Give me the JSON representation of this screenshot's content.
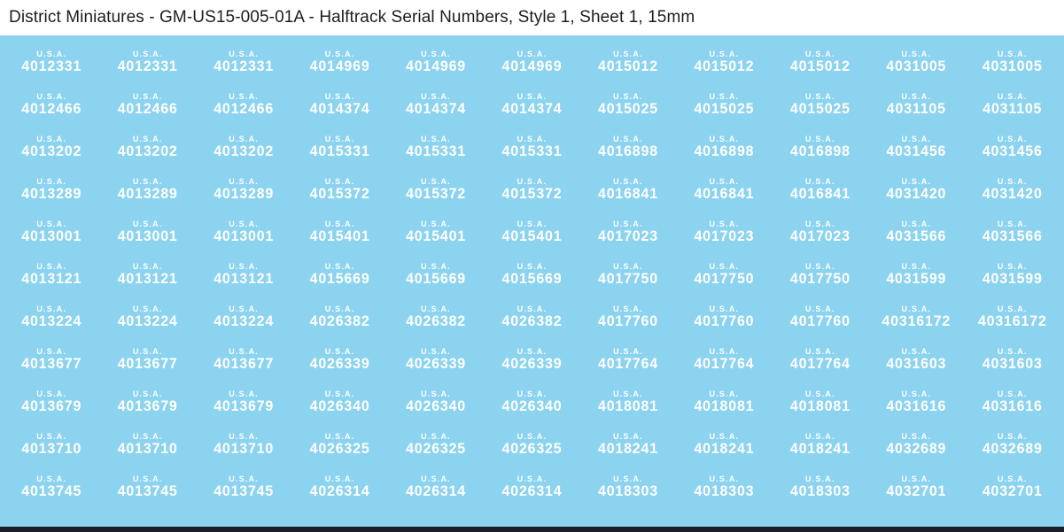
{
  "header": {
    "title": "District Miniatures - GM-US15-005-01A - Halftrack Serial Numbers, Style 1, Sheet 1, 15mm"
  },
  "decal": {
    "label": "U.S.A.",
    "rows": [
      [
        "4012331",
        "4012331",
        "4012331",
        "4014969",
        "4014969",
        "4014969",
        "4015012",
        "4015012",
        "4015012",
        "4031005",
        "4031005"
      ],
      [
        "4012466",
        "4012466",
        "4012466",
        "4014374",
        "4014374",
        "4014374",
        "4015025",
        "4015025",
        "4015025",
        "4031105",
        "4031105"
      ],
      [
        "4013202",
        "4013202",
        "4013202",
        "4015331",
        "4015331",
        "4015331",
        "4016898",
        "4016898",
        "4016898",
        "4031456",
        "4031456"
      ],
      [
        "4013289",
        "4013289",
        "4013289",
        "4015372",
        "4015372",
        "4015372",
        "4016841",
        "4016841",
        "4016841",
        "4031420",
        "4031420"
      ],
      [
        "4013001",
        "4013001",
        "4013001",
        "4015401",
        "4015401",
        "4015401",
        "4017023",
        "4017023",
        "4017023",
        "4031566",
        "4031566"
      ],
      [
        "4013121",
        "4013121",
        "4013121",
        "4015669",
        "4015669",
        "4015669",
        "4017750",
        "4017750",
        "4017750",
        "4031599",
        "4031599"
      ],
      [
        "4013224",
        "4013224",
        "4013224",
        "4026382",
        "4026382",
        "4026382",
        "4017760",
        "4017760",
        "4017760",
        "40316172",
        "40316172"
      ],
      [
        "4013677",
        "4013677",
        "4013677",
        "4026339",
        "4026339",
        "4026339",
        "4017764",
        "4017764",
        "4017764",
        "4031603",
        "4031603"
      ],
      [
        "4013679",
        "4013679",
        "4013679",
        "4026340",
        "4026340",
        "4026340",
        "4018081",
        "4018081",
        "4018081",
        "4031616",
        "4031616"
      ],
      [
        "4013710",
        "4013710",
        "4013710",
        "4026325",
        "4026325",
        "4026325",
        "4018241",
        "4018241",
        "4018241",
        "4032689",
        "4032689"
      ],
      [
        "4013745",
        "4013745",
        "4013745",
        "4026314",
        "4026314",
        "4026314",
        "4018303",
        "4018303",
        "4018303",
        "4032701",
        "4032701"
      ]
    ]
  },
  "colors": {
    "background": "#8CD3EF",
    "title_bar": "#FFFFFF",
    "title_text": "#1D1D1F",
    "decal_text": "#FFFFFF",
    "bottom_bar": "#1A1E28"
  }
}
